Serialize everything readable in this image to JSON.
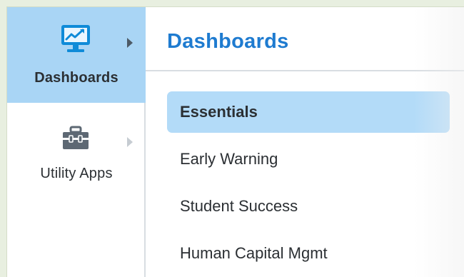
{
  "rail": {
    "items": [
      {
        "label": "Dashboards",
        "icon": "dashboard-monitor-icon",
        "active": true
      },
      {
        "label": "Utility Apps",
        "icon": "toolbox-icon",
        "active": false
      }
    ]
  },
  "panel": {
    "title": "Dashboards",
    "items": [
      {
        "label": "Essentials",
        "selected": true
      },
      {
        "label": "Early Warning",
        "selected": false
      },
      {
        "label": "Student Success",
        "selected": false
      },
      {
        "label": "Human Capital Mgmt",
        "selected": false
      }
    ]
  },
  "colors": {
    "accent": "#1e7bd0",
    "active_rail": "#a9d5f5",
    "selected_item": "#b3dbf8",
    "text": "#2b2f33"
  }
}
